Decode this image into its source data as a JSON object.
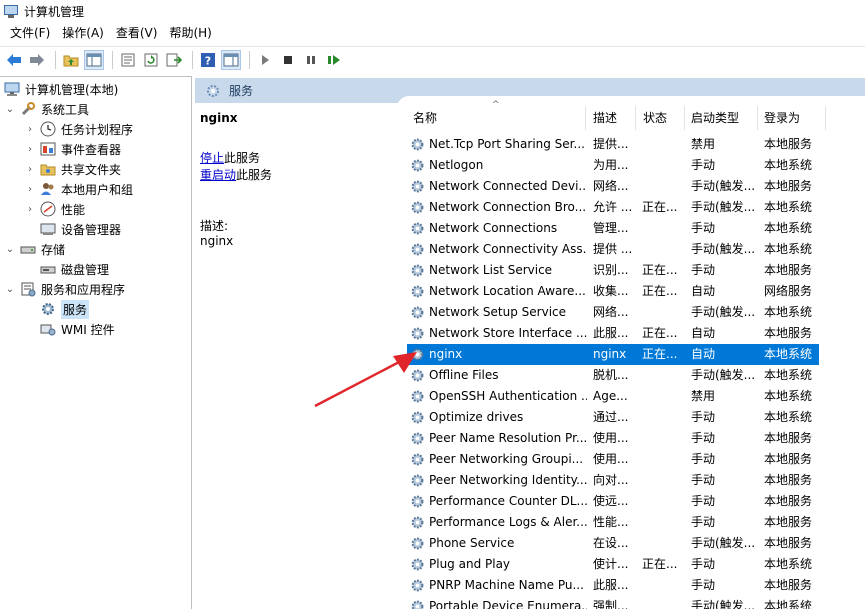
{
  "window": {
    "title": "计算机管理"
  },
  "menu": [
    "文件(F)",
    "操作(A)",
    "查看(V)",
    "帮助(H)"
  ],
  "tree": {
    "root": "计算机管理(本地)",
    "system_tools": "系统工具",
    "system_tools_items": [
      "任务计划程序",
      "事件查看器",
      "共享文件夹",
      "本地用户和组",
      "性能",
      "设备管理器"
    ],
    "storage": "存储",
    "storage_items": [
      "磁盘管理"
    ],
    "services_apps": "服务和应用程序",
    "services_apps_items": [
      "服务",
      "WMI 控件"
    ]
  },
  "middle": {
    "header": "服务",
    "selected_service": "nginx",
    "stop_link": "停止",
    "stop_rest": "此服务",
    "restart_link": "重启动",
    "restart_rest": "此服务",
    "desc_label": "描述:",
    "desc_value": "nginx"
  },
  "columns": {
    "name": "名称",
    "desc": "描述",
    "status": "状态",
    "startup": "启动类型",
    "logon": "登录为"
  },
  "rows": [
    {
      "name": "Net.Tcp Port Sharing Ser...",
      "desc": "提供...",
      "status": "",
      "startup": "禁用",
      "logon": "本地服务"
    },
    {
      "name": "Netlogon",
      "desc": "为用...",
      "status": "",
      "startup": "手动",
      "logon": "本地系统"
    },
    {
      "name": "Network Connected Devi...",
      "desc": "网络...",
      "status": "",
      "startup": "手动(触发...",
      "logon": "本地服务"
    },
    {
      "name": "Network Connection Bro...",
      "desc": "允许 ...",
      "status": "正在...",
      "startup": "手动(触发...",
      "logon": "本地系统"
    },
    {
      "name": "Network Connections",
      "desc": "管理...",
      "status": "",
      "startup": "手动",
      "logon": "本地系统"
    },
    {
      "name": "Network Connectivity Ass...",
      "desc": "提供 ...",
      "status": "",
      "startup": "手动(触发...",
      "logon": "本地系统"
    },
    {
      "name": "Network List Service",
      "desc": "识别...",
      "status": "正在...",
      "startup": "手动",
      "logon": "本地服务"
    },
    {
      "name": "Network Location Aware...",
      "desc": "收集...",
      "status": "正在...",
      "startup": "自动",
      "logon": "网络服务"
    },
    {
      "name": "Network Setup Service",
      "desc": "网络...",
      "status": "",
      "startup": "手动(触发...",
      "logon": "本地系统"
    },
    {
      "name": "Network Store Interface ...",
      "desc": "此服...",
      "status": "正在...",
      "startup": "自动",
      "logon": "本地服务"
    },
    {
      "name": "nginx",
      "desc": "nginx",
      "status": "正在...",
      "startup": "自动",
      "logon": "本地系统"
    },
    {
      "name": "Offline Files",
      "desc": "脱机...",
      "status": "",
      "startup": "手动(触发...",
      "logon": "本地系统"
    },
    {
      "name": "OpenSSH Authentication ...",
      "desc": "Age...",
      "status": "",
      "startup": "禁用",
      "logon": "本地系统"
    },
    {
      "name": "Optimize drives",
      "desc": "通过...",
      "status": "",
      "startup": "手动",
      "logon": "本地系统"
    },
    {
      "name": "Peer Name Resolution Pr...",
      "desc": "使用...",
      "status": "",
      "startup": "手动",
      "logon": "本地服务"
    },
    {
      "name": "Peer Networking Groupi...",
      "desc": "使用...",
      "status": "",
      "startup": "手动",
      "logon": "本地服务"
    },
    {
      "name": "Peer Networking Identity...",
      "desc": "向对...",
      "status": "",
      "startup": "手动",
      "logon": "本地服务"
    },
    {
      "name": "Performance Counter DL...",
      "desc": "使远...",
      "status": "",
      "startup": "手动",
      "logon": "本地服务"
    },
    {
      "name": "Performance Logs & Aler...",
      "desc": "性能...",
      "status": "",
      "startup": "手动",
      "logon": "本地服务"
    },
    {
      "name": "Phone Service",
      "desc": "在设...",
      "status": "",
      "startup": "手动(触发...",
      "logon": "本地服务"
    },
    {
      "name": "Plug and Play",
      "desc": "使计...",
      "status": "正在...",
      "startup": "手动",
      "logon": "本地系统"
    },
    {
      "name": "PNRP Machine Name Pu...",
      "desc": "此服...",
      "status": "",
      "startup": "手动",
      "logon": "本地服务"
    },
    {
      "name": "Portable Device Enumera...",
      "desc": "强制...",
      "status": "",
      "startup": "手动(触发...",
      "logon": "本地系统"
    }
  ],
  "selected_index": 10,
  "colors": {
    "selection": "#0078d7",
    "header_band": "#c8d9ec",
    "arrow": "#e0262b",
    "link": "#0000cc"
  },
  "icons": [
    "back-arrow-icon",
    "forward-arrow-icon",
    "folder-up-icon",
    "console-tree-icon",
    "properties-icon",
    "refresh-icon",
    "export-icon",
    "help-icon",
    "show-hide-icon",
    "play-icon",
    "stop-icon",
    "pause-icon",
    "resume-icon",
    "gear-icon"
  ]
}
